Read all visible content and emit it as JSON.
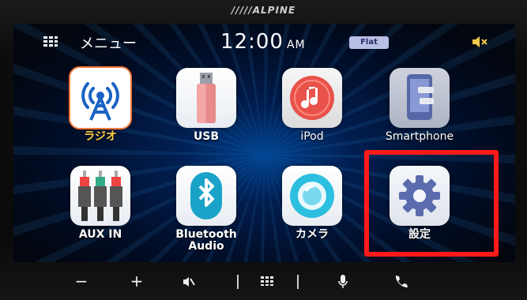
{
  "brand": "/////ALPINE",
  "status": {
    "menu_label": "メニュー",
    "time": "12:00",
    "ampm": "AM",
    "eq_preset": "Flat",
    "mute_icon": "speaker-mute-icon"
  },
  "apps": [
    {
      "label": "ラジオ",
      "icon": "radio-tower-icon"
    },
    {
      "label": "USB",
      "icon": "usb-stick-icon"
    },
    {
      "label": "iPod",
      "icon": "ipod-music-icon"
    },
    {
      "label": "Smartphone",
      "icon": "smartphone-icon"
    },
    {
      "label": "AUX IN",
      "icon": "aux-plugs-icon"
    },
    {
      "label": "Bluetooth Audio",
      "icon": "bluetooth-icon"
    },
    {
      "label": "カメラ",
      "icon": "camera-lens-icon"
    },
    {
      "label": "設定",
      "icon": "gear-icon"
    }
  ],
  "colors": {
    "highlight": "#ff1a1a",
    "radio_label": "#ffd24a",
    "screen_glow": "#0078ff"
  },
  "bottom_bar": {
    "minus": "−",
    "plus": "+",
    "icons": [
      "volume-down-button",
      "volume-up-button",
      "mute-button",
      "menu-grid-button",
      "voice-mic-button",
      "phone-button"
    ]
  }
}
